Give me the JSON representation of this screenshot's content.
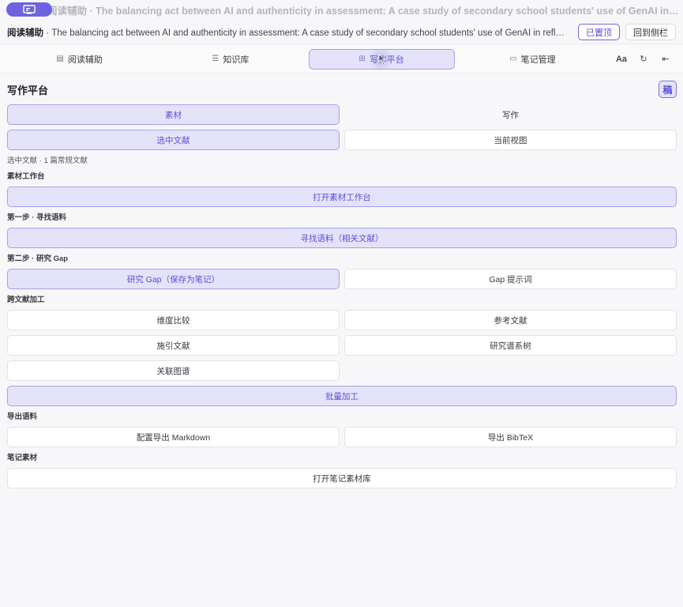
{
  "ghost_bar": {
    "title": "阅读辅助 · The balancing act between AI and authenticity in assessment: A case study of secondary school students' use of GenAI in reflective wr..."
  },
  "header": {
    "prefix": "阅读辅助",
    "title": " · The balancing act between AI and authenticity in assessment: A case study of secondary school students' use of GenAI in reflective wri...",
    "pinned_label": "已置顶",
    "sidebar_label": "回到侧栏"
  },
  "tabs": [
    {
      "label": "阅读辅助",
      "icon": "document-icon"
    },
    {
      "label": "知识库",
      "icon": "database-icon"
    },
    {
      "label": "写作平台",
      "icon": "grid-icon"
    },
    {
      "label": "笔记管理",
      "icon": "folder-icon"
    }
  ],
  "toolbar": {
    "font_label": "Aa",
    "refresh_icon": "refresh-icon",
    "collapse_icon": "collapse-icon"
  },
  "page": {
    "title": "写作平台",
    "draft_label": "稿"
  },
  "mode_tabs": {
    "material": "素材",
    "writing": "写作"
  },
  "scope_tabs": {
    "selected": "选中文献",
    "current_view": "当前视图"
  },
  "selected_info": "选中文献 · 1 篇常规文献",
  "sections": {
    "workbench": {
      "label": "素材工作台",
      "button": "打开素材工作台"
    },
    "step1": {
      "label": "第一步 · 寻找语料",
      "button": "寻找语料（相关文献）"
    },
    "step2": {
      "label": "第二步 · 研究 Gap",
      "primary_button": "研究 Gap（保存为笔记）",
      "secondary_button": "Gap 提示词"
    },
    "cross": {
      "label": "跨文献加工",
      "buttons": [
        "维度比较",
        "参考文献",
        "施引文献",
        "研究谱系树",
        "关联图谱"
      ],
      "batch_button": "批量加工"
    },
    "export": {
      "label": "导出语料",
      "markdown_button": "配置导出 Markdown",
      "bibtex_button": "导出 BibTeX"
    },
    "notes": {
      "label": "笔记素材",
      "button": "打开笔记素材库"
    }
  },
  "colors": {
    "accent": "#6c63e0",
    "accent_light": "#e4e2f8",
    "accent_border": "#a6a0ea",
    "background": "#f7f7f9"
  }
}
